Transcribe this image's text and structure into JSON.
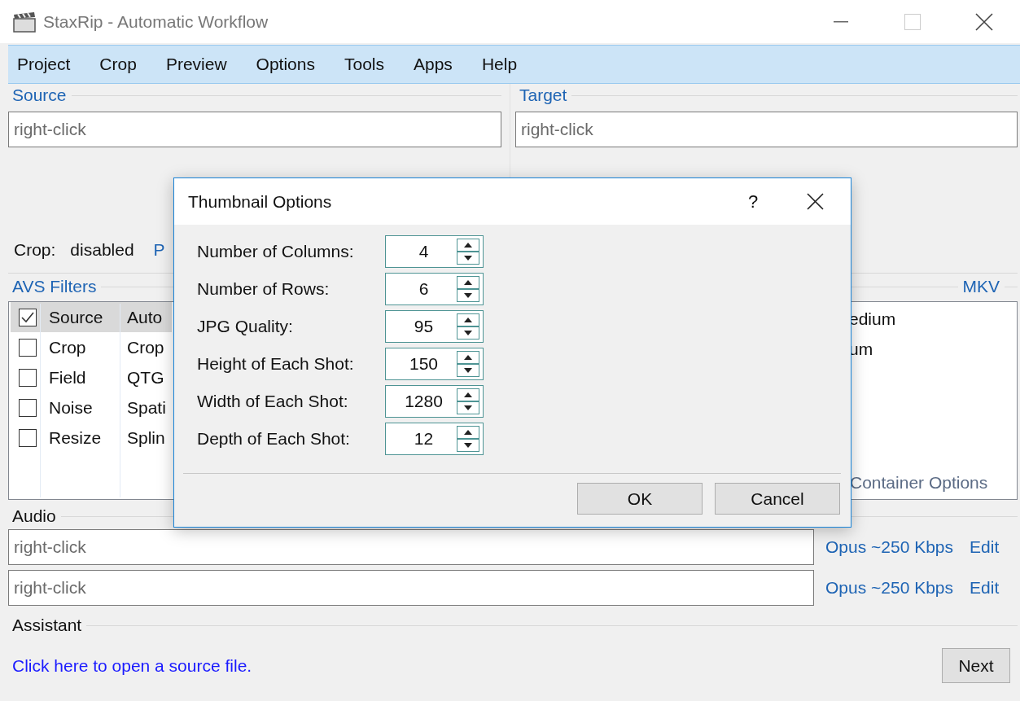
{
  "window": {
    "title": "StaxRip - Automatic Workflow"
  },
  "menu": [
    "Project",
    "Crop",
    "Preview",
    "Options",
    "Tools",
    "Apps",
    "Help"
  ],
  "source": {
    "label": "Source",
    "value": "right-click"
  },
  "target": {
    "label": "Target",
    "value": "right-click"
  },
  "crop_status": {
    "label": "Crop:",
    "value": "disabled",
    "column_3": "P"
  },
  "filters": {
    "label": "AVS Filters",
    "rows": [
      {
        "checked": true,
        "selected": true,
        "name": "Source",
        "column_2": "Auto"
      },
      {
        "checked": false,
        "selected": false,
        "name": "Crop",
        "column_2": "Crop"
      },
      {
        "checked": false,
        "selected": false,
        "name": "Field",
        "column_2": "QTG"
      },
      {
        "checked": false,
        "selected": false,
        "name": "Noise",
        "column_2": "Spati"
      },
      {
        "checked": false,
        "selected": false,
        "name": "Resize",
        "column_2": "Splin"
      }
    ]
  },
  "container": {
    "label": "MKV",
    "items": [
      "edium",
      "um"
    ],
    "options_link": "Container Options"
  },
  "audio": {
    "label": "Audio",
    "tracks": [
      {
        "value": "right-click",
        "codec": "Opus ~250 Kbps",
        "edit": "Edit"
      },
      {
        "value": "right-click",
        "codec": "Opus ~250 Kbps",
        "edit": "Edit"
      }
    ]
  },
  "assistant": {
    "label": "Assistant",
    "link": "Click here to open a source file.",
    "next": "Next"
  },
  "dialog": {
    "title": "Thumbnail Options",
    "help": "?",
    "fields": [
      {
        "label": "Number of Columns:",
        "value": "4"
      },
      {
        "label": "Number of Rows:",
        "value": "6"
      },
      {
        "label": "JPG Quality:",
        "value": "95"
      },
      {
        "label": "Height of Each Shot:",
        "value": "150"
      },
      {
        "label": "Width of Each Shot:",
        "value": "1280"
      },
      {
        "label": "Depth of Each Shot:",
        "value": "12"
      }
    ],
    "buttons": [
      "OK",
      "Cancel"
    ]
  }
}
